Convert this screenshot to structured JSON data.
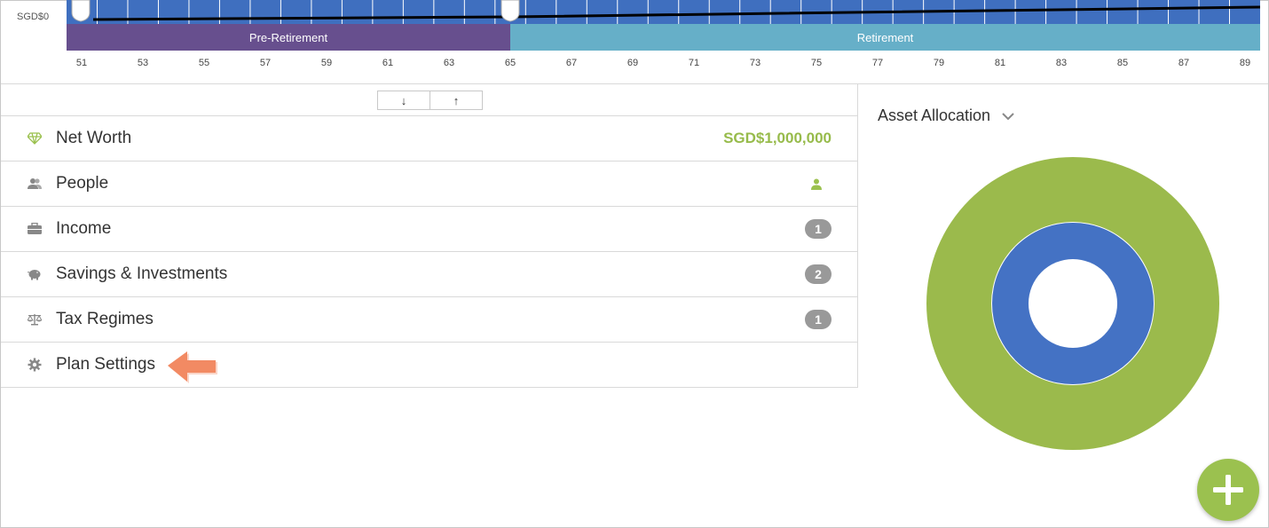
{
  "timeline": {
    "y_axis_label": "SGD$0",
    "phases": [
      {
        "label": "Pre-Retirement",
        "color": "#674f8e"
      },
      {
        "label": "Retirement",
        "color": "#66afc8"
      }
    ],
    "ages": [
      "51",
      "53",
      "55",
      "57",
      "59",
      "61",
      "63",
      "65",
      "67",
      "69",
      "71",
      "73",
      "75",
      "77",
      "79",
      "81",
      "83",
      "85",
      "87",
      "89"
    ],
    "bar_color": "#3f6fbf"
  },
  "sort_controls": {
    "down_label": "↓",
    "up_label": "↑"
  },
  "sections": [
    {
      "label": "Net Worth",
      "value": "SGD$1,000,000",
      "icon": "diamond-icon"
    },
    {
      "label": "People",
      "icon": "people-icon",
      "indicator": "person-icon"
    },
    {
      "label": "Income",
      "badge": "1",
      "icon": "briefcase-icon"
    },
    {
      "label": "Savings & Investments",
      "badge": "2",
      "icon": "piggy-bank-icon"
    },
    {
      "label": "Tax Regimes",
      "badge": "1",
      "icon": "scales-icon"
    },
    {
      "label": "Plan Settings",
      "icon": "gear-icon",
      "callout": "arrow-pointer-icon"
    }
  ],
  "asset_allocation": {
    "title": "Asset Allocation",
    "outer_color": "#9bba4c",
    "inner_color": "#4472c4"
  },
  "colors": {
    "accent_green": "#97bb4b",
    "badge_gray": "#999999",
    "callout_orange": "#f28a63",
    "fab_green": "#9bc14f"
  },
  "add_button": {
    "icon": "plus-icon"
  }
}
